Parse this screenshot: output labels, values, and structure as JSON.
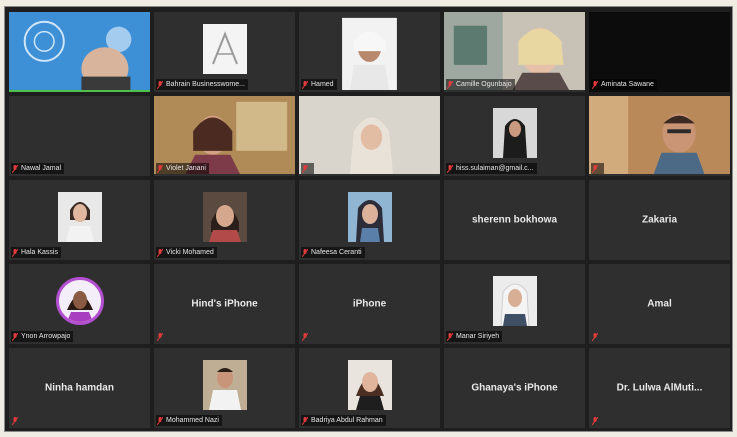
{
  "app": {
    "title": "Zoom meeting gallery view"
  },
  "colors": {
    "active_speaker": "#4cc24a",
    "muted_icon": "#e23b3b",
    "tile_bg": "#2f2f2f"
  },
  "participants": [
    {
      "name": "",
      "type": "video"
    },
    {
      "name": "Bahrain Businesswome...",
      "type": "thumb"
    },
    {
      "name": "Hamed",
      "type": "video"
    },
    {
      "name": "Camille Ogunbajo",
      "type": "video"
    },
    {
      "name": "Aminata Sawane",
      "type": "dark"
    },
    {
      "name": "Nawal Jamal",
      "type": "empty"
    },
    {
      "name": "Violet Janani",
      "type": "video"
    },
    {
      "name": "",
      "type": "video"
    },
    {
      "name": "hiss.sulaiman@gmail.c...",
      "type": "thumb"
    },
    {
      "name": "",
      "type": "video"
    },
    {
      "name": "Hala Kassis",
      "type": "thumb"
    },
    {
      "name": "Vicki Mohamed",
      "type": "thumb"
    },
    {
      "name": "Nafeesa Ceranti",
      "type": "thumb"
    },
    {
      "name": "",
      "center": "sherenn bokhowa",
      "type": "name"
    },
    {
      "name": "",
      "center": "Zakaria",
      "type": "name"
    },
    {
      "name": "Ynon Arrowpajo",
      "type": "round"
    },
    {
      "name": "",
      "center": "Hind's iPhone",
      "type": "name"
    },
    {
      "name": "",
      "center": "iPhone",
      "type": "name"
    },
    {
      "name": "Manar Siriyeh",
      "type": "thumb"
    },
    {
      "name": "",
      "center": "Amal",
      "type": "name"
    },
    {
      "name": "",
      "center": "Ninha hamdan",
      "type": "name"
    },
    {
      "name": "Mohammed Nazi",
      "type": "thumb"
    },
    {
      "name": "Badriya Abdul Rahman",
      "type": "thumb"
    },
    {
      "name": "",
      "center": "Ghanaya's iPhone",
      "type": "name"
    },
    {
      "name": "",
      "center": "Dr. Lulwa AlMuti...",
      "type": "name"
    }
  ]
}
